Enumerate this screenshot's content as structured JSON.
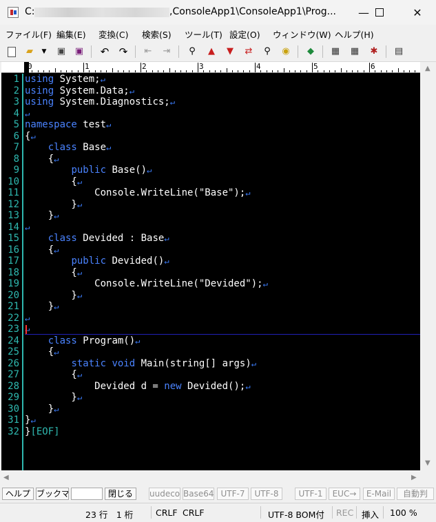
{
  "window": {
    "title_prefix": "C:",
    "title_suffix": ",ConsoleApp1\\ConsoleApp1\\Prog..."
  },
  "menu": [
    "ファイル(F)",
    "編集(E)",
    "変換(C)",
    "検索(S)",
    "ツール(T)",
    "設定(O)",
    "ウィンドウ(W)",
    "ヘルプ(H)"
  ],
  "toolbar": {
    "icons": [
      "new-file-icon",
      "open-folder-icon",
      "dropdown-icon",
      "save-icon",
      "save-all-icon",
      "undo-icon",
      "redo-icon",
      "jump-back-icon",
      "jump-forward-icon",
      "search-icon",
      "search-prev-icon",
      "search-next-icon",
      "replace-icon",
      "grep-icon",
      "highlight-icon",
      "outline-icon",
      "compare-icon",
      "settings-icon",
      "tag-icon",
      "window-list-icon"
    ]
  },
  "ruler": {
    "marks": [
      "0",
      "1",
      "2",
      "3",
      "4",
      "5",
      "6"
    ]
  },
  "editor": {
    "line_numbers": [
      "1",
      "2",
      "3",
      "4",
      "5",
      "6",
      "7",
      "8",
      "9",
      "10",
      "11",
      "12",
      "13",
      "14",
      "15",
      "16",
      "17",
      "18",
      "19",
      "20",
      "21",
      "22",
      "23",
      "24",
      "25",
      "26",
      "27",
      "28",
      "29",
      "30",
      "31",
      "32"
    ],
    "eof_marker": "[EOF]",
    "newline_mark": "↵",
    "keyword_color": "#4a83ff",
    "line_number_color": "#2fb9b0",
    "background": "#000000",
    "lines": [
      [
        {
          "t": "using",
          "k": 1
        },
        {
          "t": " System;"
        }
      ],
      [
        {
          "t": "using",
          "k": 1
        },
        {
          "t": " System.Data;"
        }
      ],
      [
        {
          "t": "using",
          "k": 1
        },
        {
          "t": " System.Diagnostics;"
        }
      ],
      [],
      [
        {
          "t": "namespace",
          "k": 1
        },
        {
          "t": " test"
        }
      ],
      [
        {
          "t": "{"
        }
      ],
      [
        {
          "t": "    "
        },
        {
          "t": "class",
          "k": 1
        },
        {
          "t": " Base"
        }
      ],
      [
        {
          "t": "    {"
        }
      ],
      [
        {
          "t": "        "
        },
        {
          "t": "public",
          "k": 1
        },
        {
          "t": " Base()"
        }
      ],
      [
        {
          "t": "        {"
        }
      ],
      [
        {
          "t": "            Console.WriteLine(\"Base\");"
        }
      ],
      [
        {
          "t": "        }"
        }
      ],
      [
        {
          "t": "    }"
        }
      ],
      [],
      [
        {
          "t": "    "
        },
        {
          "t": "class",
          "k": 1
        },
        {
          "t": " Devided : Base"
        }
      ],
      [
        {
          "t": "    {"
        }
      ],
      [
        {
          "t": "        "
        },
        {
          "t": "public",
          "k": 1
        },
        {
          "t": " Devided()"
        }
      ],
      [
        {
          "t": "        {"
        }
      ],
      [
        {
          "t": "            Console.WriteLine(\"Devided\");"
        }
      ],
      [
        {
          "t": "        }"
        }
      ],
      [
        {
          "t": "    }"
        }
      ],
      [],
      [],
      [
        {
          "t": "    "
        },
        {
          "t": "class",
          "k": 1
        },
        {
          "t": " Program()"
        }
      ],
      [
        {
          "t": "    {"
        }
      ],
      [
        {
          "t": "        "
        },
        {
          "t": "static",
          "k": 1
        },
        {
          "t": " "
        },
        {
          "t": "void",
          "k": 1
        },
        {
          "t": " Main(string[] args)"
        }
      ],
      [
        {
          "t": "        {"
        }
      ],
      [
        {
          "t": "            Devided d = "
        },
        {
          "t": "new",
          "k": 1
        },
        {
          "t": " Devided();"
        }
      ],
      [
        {
          "t": "        }"
        }
      ],
      [
        {
          "t": "    }"
        }
      ],
      [
        {
          "t": "}"
        }
      ],
      [
        {
          "t": "}"
        }
      ]
    ]
  },
  "findbar": {
    "help": "ヘルプ",
    "bookmark": "ブックマ",
    "search_value": "",
    "close": "閉じる",
    "opts": [
      "uudeco",
      "Base64",
      "UTF-7",
      "UTF-8",
      "UTF-1",
      "EUC→",
      "E-Mail",
      "自動判"
    ]
  },
  "status": {
    "position": "23 行　1 桁",
    "eol_1": "CRLF",
    "eol_2": "CRLF",
    "encoding": "UTF-8 BOM付",
    "rec": "REC",
    "insert": "挿入",
    "zoom": "100 %"
  }
}
